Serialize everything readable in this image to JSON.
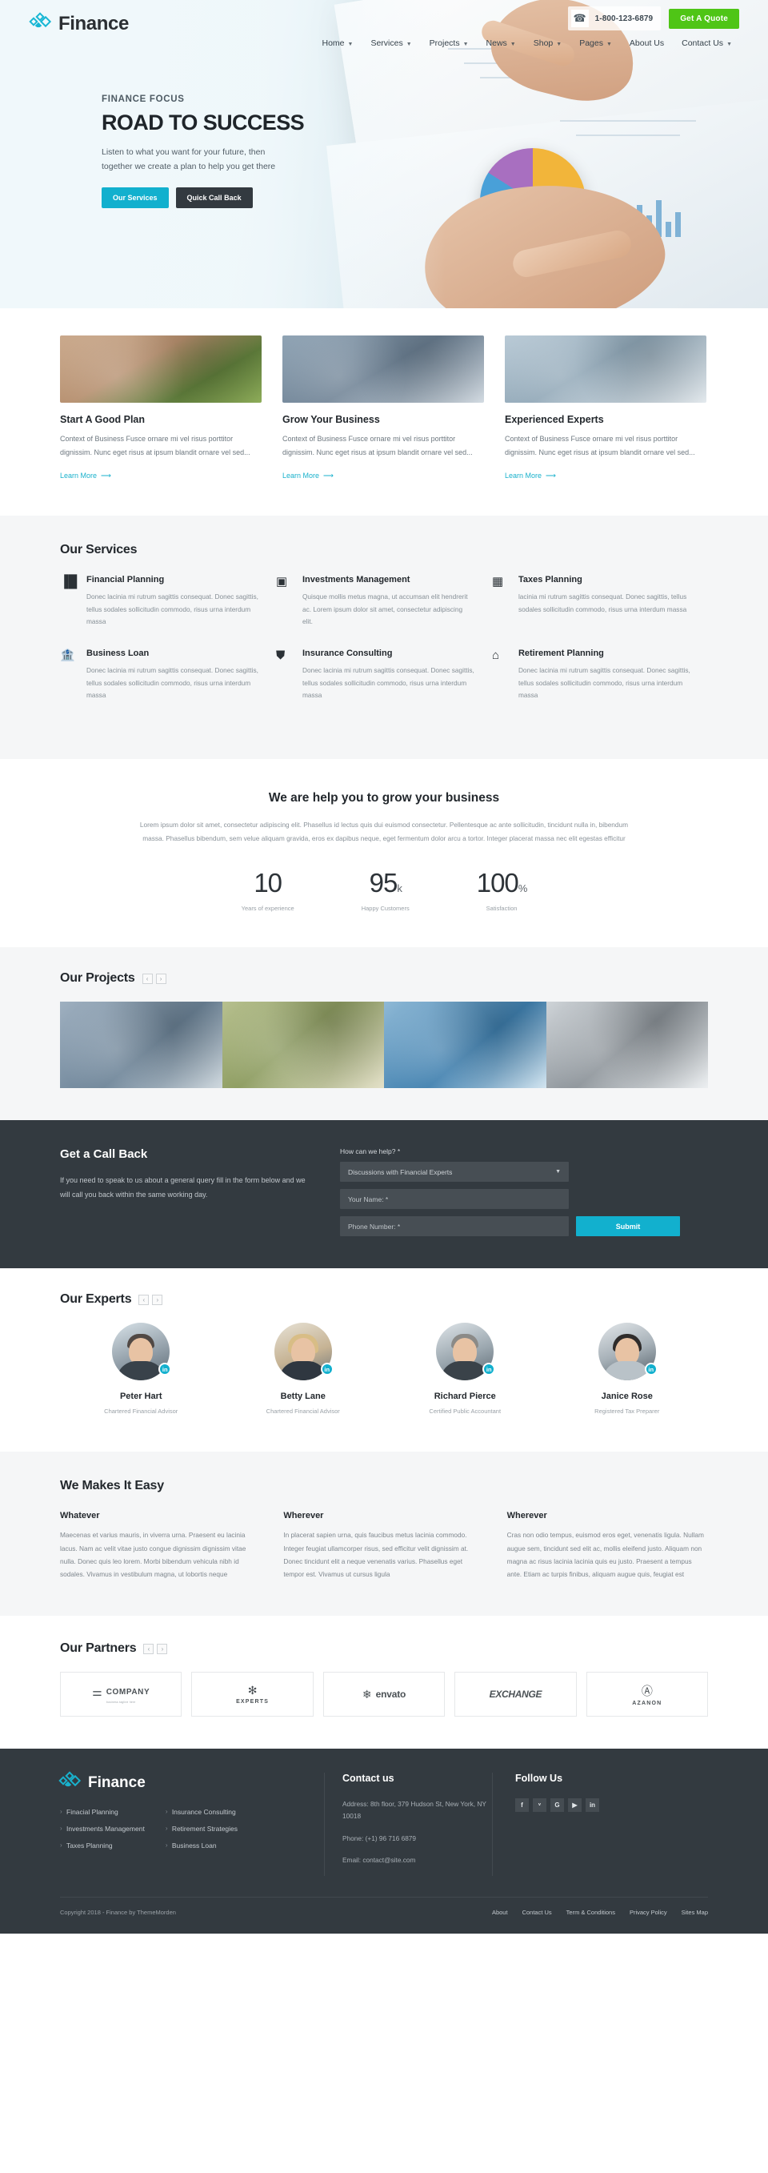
{
  "header": {
    "brand": "Finance",
    "phone": "1-800-123-6879",
    "quote_button": "Get A Quote",
    "nav": [
      {
        "label": "Home",
        "caret": true
      },
      {
        "label": "Services",
        "caret": true
      },
      {
        "label": "Projects",
        "caret": true
      },
      {
        "label": "News",
        "caret": true
      },
      {
        "label": "Shop",
        "caret": true
      },
      {
        "label": "Pages",
        "caret": true
      },
      {
        "label": "About Us",
        "caret": false
      },
      {
        "label": "Contact Us",
        "caret": true
      }
    ]
  },
  "hero": {
    "kicker": "FINANCE FOCUS",
    "title": "ROAD TO SUCCESS",
    "subtitle": "Listen to what you want for your future, then together we create a plan to help you get there",
    "btn_primary": "Our Services",
    "btn_secondary": "Quick Call Back"
  },
  "features": [
    {
      "title": "Start A Good Plan",
      "desc": "Context of Business Fusce ornare mi vel risus porttitor dignissim. Nunc eget risus at ipsum blandit ornare vel sed...",
      "link": "Learn More"
    },
    {
      "title": "Grow Your Business",
      "desc": "Context of Business Fusce ornare mi vel risus porttitor dignissim. Nunc eget risus at ipsum blandit ornare vel sed...",
      "link": "Learn More"
    },
    {
      "title": "Experienced Experts",
      "desc": "Context of Business Fusce ornare mi vel risus porttitor dignissim. Nunc eget risus at ipsum blandit ornare vel sed...",
      "link": "Learn More"
    }
  ],
  "services": {
    "title": "Our Services",
    "items": [
      {
        "icon": "bar-chart-icon",
        "glyph": "▐█",
        "name": "Financial Planning",
        "desc": "Donec lacinia mi rutrum sagittis consequat. Donec sagittis, tellus sodales sollicitudin commodo, risus urna interdum massa"
      },
      {
        "icon": "money-icon",
        "glyph": "▣",
        "name": "Investments Management",
        "desc": "Quisque mollis metus magna, ut accumsan elit hendrerit ac. Lorem ipsum dolor sit amet, consectetur adipiscing elit."
      },
      {
        "icon": "calculator-icon",
        "glyph": "▦",
        "name": "Taxes Planning",
        "desc": "lacinia mi rutrum sagittis consequat. Donec sagittis, tellus sodales sollicitudin commodo, risus urna interdum massa"
      },
      {
        "icon": "bank-icon",
        "glyph": "🏦",
        "name": "Business Loan",
        "desc": "Donec lacinia mi rutrum sagittis consequat. Donec sagittis, tellus sodales sollicitudin commodo, risus urna interdum massa"
      },
      {
        "icon": "shield-icon",
        "glyph": "⛊",
        "name": "Insurance Consulting",
        "desc": "Donec lacinia mi rutrum sagittis consequat. Donec sagittis, tellus sodales sollicitudin commodo, risus urna interdum massa"
      },
      {
        "icon": "home-icon",
        "glyph": "⌂",
        "name": "Retirement Planning",
        "desc": "Donec lacinia mi rutrum sagittis consequat. Donec sagittis, tellus sodales sollicitudin commodo, risus urna interdum massa"
      }
    ]
  },
  "grow": {
    "title": "We are help you to grow your business",
    "paragraph": "Lorem ipsum dolor sit amet, consectetur adipiscing elit. Phasellus id lectus quis dui euismod consectetur. Pellentesque ac ante sollicitudin, tincidunt nulla in, bibendum massa. Phasellus bibendum, sem velue aliquam gravida, eros ex dapibus neque, eget fermentum dolor arcu a tortor. Integer placerat massa nec elit egestas efficitur",
    "stats": [
      {
        "value": "10",
        "unit": "",
        "label": "Years of experience"
      },
      {
        "value": "95",
        "unit": "k",
        "label": "Happy Customers"
      },
      {
        "value": "100",
        "unit": "%",
        "label": "Satisfaction"
      }
    ]
  },
  "projects": {
    "title": "Our Projects",
    "prev": "‹",
    "next": "›",
    "items": [
      "project-meeting",
      "project-savings-jar",
      "project-glasses-report",
      "project-laptop-desk"
    ]
  },
  "callback": {
    "title": "Get a Call Back",
    "paragraph": "If you need to speak to us about a general query fill in the form below and we will call you back within the same working day.",
    "field_label": "How can we help? *",
    "select_value": "Discussions with Financial Experts",
    "name_placeholder": "Your Name: *",
    "phone_placeholder": "Phone Number: *",
    "submit": "Submit"
  },
  "experts": {
    "title": "Our Experts",
    "prev": "‹",
    "next": "›",
    "items": [
      {
        "name": "Peter Hart",
        "role": "Chartered Financial Advisor",
        "badge": "in"
      },
      {
        "name": "Betty Lane",
        "role": "Chartered Financial Advisor",
        "badge": "in"
      },
      {
        "name": "Richard Pierce",
        "role": "Certified Public Accountant",
        "badge": "in"
      },
      {
        "name": "Janice Rose",
        "role": "Registered Tax Preparer",
        "badge": "in"
      }
    ]
  },
  "easy": {
    "title": "We Makes It Easy",
    "columns": [
      {
        "heading": "Whatever",
        "text": "Maecenas et varius mauris, in viverra urna. Praesent eu lacinia lacus. Nam ac velit vitae justo congue dignissim dignissim vitae nulla. Donec quis leo lorem. Morbi bibendum vehicula nibh id sodales. Vivamus in vestibulum magna, ut lobortis neque"
      },
      {
        "heading": "Wherever",
        "text": "In placerat sapien urna, quis faucibus metus lacinia commodo. Integer feugiat ullamcorper risus, sed efficitur velit dignissim at. Donec tincidunt elit a neque venenatis varius. Phasellus eget tempor est. Vivamus ut cursus ligula"
      },
      {
        "heading": "Wherever",
        "text": "Cras non odio tempus, euismod eros eget, venenatis ligula. Nullam augue sem, tincidunt sed elit ac, mollis eleifend justo. Aliquam non magna ac risus lacinia lacinia quis eu justo. Praesent a tempus ante. Etiam ac turpis finibus, aliquam augue quis, feugiat est"
      }
    ]
  },
  "partners": {
    "title": "Our Partners",
    "prev": "‹",
    "next": "›",
    "items": [
      {
        "name": "COMPANY",
        "sub": "",
        "tiny": "business tagline here",
        "style": "company"
      },
      {
        "name": "EXPERTS",
        "sub": "",
        "tiny": "",
        "style": "experts"
      },
      {
        "name": "envato",
        "sub": "",
        "tiny": "",
        "style": "envato"
      },
      {
        "name": "EXCHANGE",
        "sub": "",
        "tiny": "",
        "style": "exchange"
      },
      {
        "name": "AZANON",
        "sub": "",
        "tiny": "",
        "style": "azanon"
      }
    ]
  },
  "footer": {
    "brand": "Finance",
    "links_col1": [
      "Finacial Planning",
      "Investments Management",
      "Taxes Planning"
    ],
    "links_col2": [
      "Insurance Consulting",
      "Retirement Strategies",
      "Business Loan"
    ],
    "contact_heading": "Contact us",
    "address": "Address: 8th floor, 379 Hudson St, New York, NY 10018",
    "phone": "Phone: (+1) 96 716 6879",
    "email": "Email: contact@site.com",
    "follow_heading": "Follow Us",
    "socials": [
      {
        "name": "facebook-icon",
        "glyph": "f"
      },
      {
        "name": "twitter-icon",
        "glyph": "ᵛ"
      },
      {
        "name": "google-plus-icon",
        "glyph": "G"
      },
      {
        "name": "youtube-icon",
        "glyph": "▶"
      },
      {
        "name": "linkedin-icon",
        "glyph": "in"
      }
    ],
    "copyright": "Copyright 2018 - Finance by ThemeMorden",
    "bottom_links": [
      "About",
      "Contact Us",
      "Term & Conditions",
      "Privacy Policy",
      "Sites Map"
    ]
  }
}
